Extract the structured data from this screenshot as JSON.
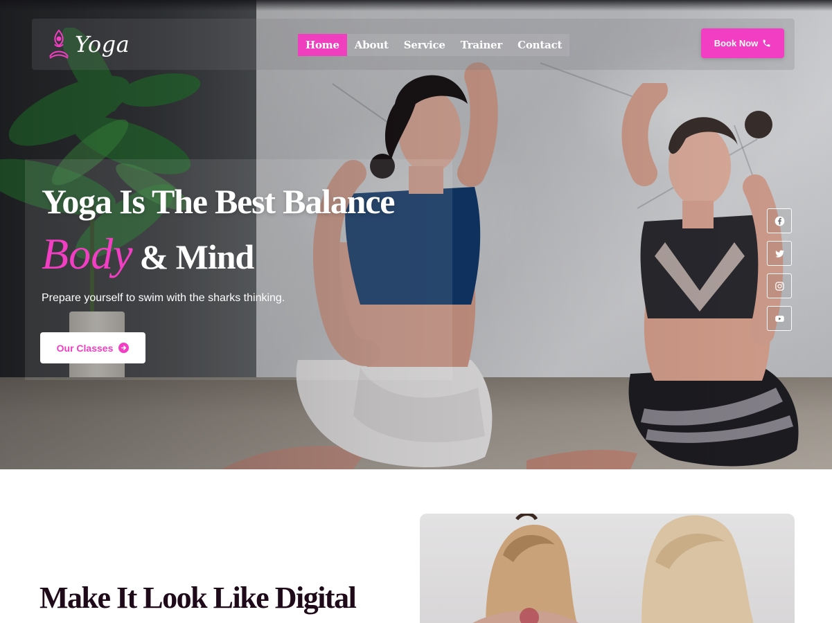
{
  "brand": {
    "name": "Yoga"
  },
  "nav": {
    "items": [
      {
        "label": "Home",
        "active": true
      },
      {
        "label": "About",
        "active": false
      },
      {
        "label": "Service",
        "active": false
      },
      {
        "label": "Trainer",
        "active": false
      },
      {
        "label": "Contact",
        "active": false
      }
    ]
  },
  "header": {
    "book_label": "Book Now"
  },
  "hero": {
    "title_line1": "Yoga Is The Best Balance",
    "title_accent": "Body",
    "title_rest": "& Mind",
    "subtitle": "Prepare yourself to swim with the sharks thinking.",
    "cta_label": "Our Classes"
  },
  "social": [
    "facebook-icon",
    "twitter-icon",
    "instagram-icon",
    "youtube-icon"
  ],
  "about": {
    "title": "Make It Look Like Digital"
  },
  "colors": {
    "accent": "#f23ec3",
    "heading_dark": "#1f0a1a"
  }
}
